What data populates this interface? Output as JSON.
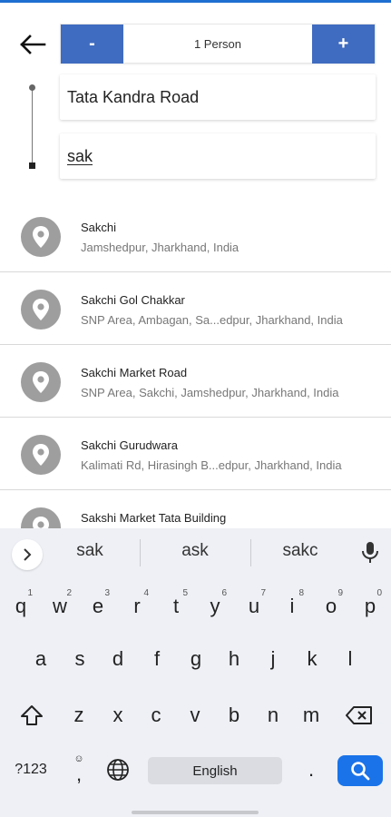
{
  "header": {
    "back_icon": "arrow-left-icon",
    "stepper": {
      "minus_label": "-",
      "count_label": "1 Person",
      "plus_label": "+"
    }
  },
  "route": {
    "from_value": "Tata Kandra Road",
    "to_value": "sak"
  },
  "results": [
    {
      "title": "Sakchi",
      "subtitle": "Jamshedpur, Jharkhand, India",
      "icon": "location-pin-icon"
    },
    {
      "title": "Sakchi Gol Chakkar",
      "subtitle": "SNP Area, Ambagan, Sa...edpur, Jharkhand, India",
      "icon": "location-pin-icon"
    },
    {
      "title": "Sakchi Market Road",
      "subtitle": "SNP Area, Sakchi, Jamshedpur, Jharkhand, India",
      "icon": "location-pin-icon"
    },
    {
      "title": "Sakchi Gurudwara",
      "subtitle": "Kalimati Rd, Hirasingh B...edpur, Jharkhand, India",
      "icon": "location-pin-icon"
    },
    {
      "title": "Sakshi Market Tata Building",
      "subtitle": "",
      "icon": "location-pin-icon"
    }
  ],
  "keyboard": {
    "suggestions": [
      "sak",
      "ask",
      "sakc"
    ],
    "row1": [
      {
        "key": "q",
        "hint": "1"
      },
      {
        "key": "w",
        "hint": "2"
      },
      {
        "key": "e",
        "hint": "3"
      },
      {
        "key": "r",
        "hint": "4"
      },
      {
        "key": "t",
        "hint": "5"
      },
      {
        "key": "y",
        "hint": "6"
      },
      {
        "key": "u",
        "hint": "7"
      },
      {
        "key": "i",
        "hint": "8"
      },
      {
        "key": "o",
        "hint": "9"
      },
      {
        "key": "p",
        "hint": "0"
      }
    ],
    "row2": [
      "a",
      "s",
      "d",
      "f",
      "g",
      "h",
      "j",
      "k",
      "l"
    ],
    "row3": [
      "z",
      "x",
      "c",
      "v",
      "b",
      "n",
      "m"
    ],
    "symbols_label": "?123",
    "comma_label": ",",
    "period_label": ".",
    "space_label": "English"
  },
  "colors": {
    "accent": "#3f6cc0",
    "search_key": "#1a73e8",
    "pin": "#9e9e9e"
  }
}
